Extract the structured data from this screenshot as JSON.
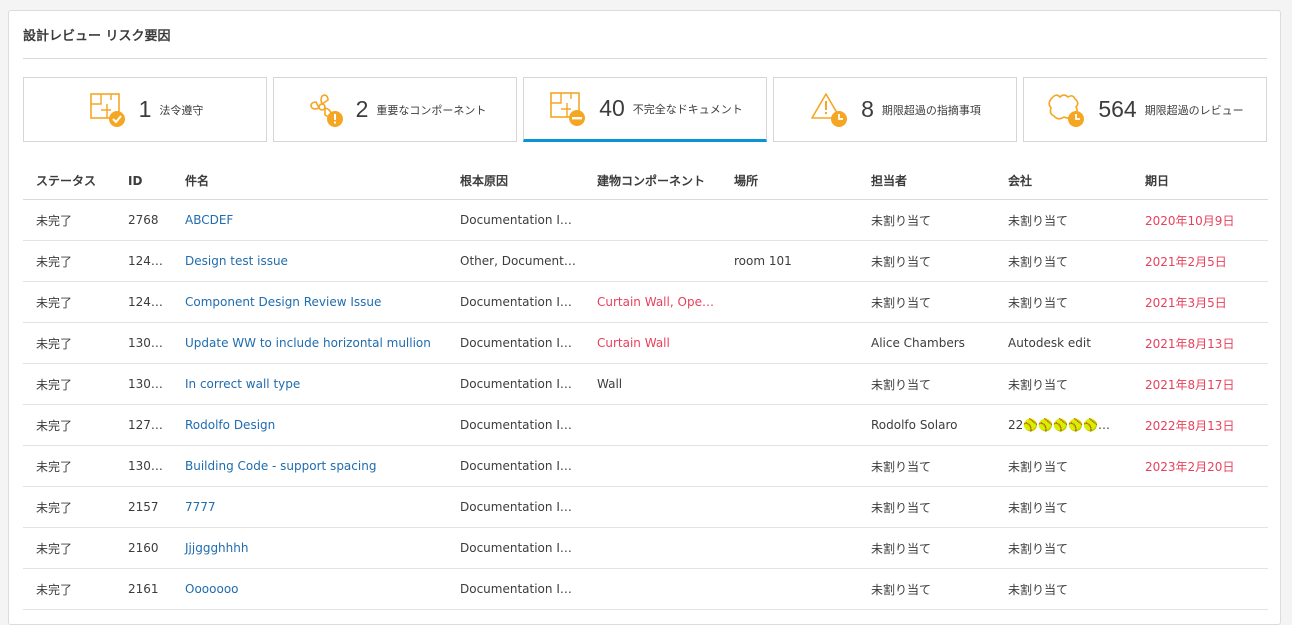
{
  "panel": {
    "title": "設計レビュー リスク要因"
  },
  "colors": {
    "accent": "#0696d7",
    "icon_orange": "#f5a623",
    "overdue_red": "#e8405c",
    "link_blue": "#1f6cae"
  },
  "cards": [
    {
      "count": "1",
      "label": "法令遵守",
      "icon": "blueprint-check-icon",
      "active": false
    },
    {
      "count": "2",
      "label": "重要なコンポーネント",
      "icon": "fan-warning-icon",
      "active": false
    },
    {
      "count": "40",
      "label": "不完全なドキュメント",
      "icon": "blueprint-minus-icon",
      "active": true
    },
    {
      "count": "8",
      "label": "期限超過の指摘事項",
      "icon": "warning-clock-icon",
      "active": false
    },
    {
      "count": "564",
      "label": "期限超過のレビュー",
      "icon": "cloud-clock-icon",
      "active": false
    }
  ],
  "table": {
    "headers": [
      "ステータス",
      "ID",
      "件名",
      "根本原因",
      "建物コンポーネント",
      "場所",
      "担当者",
      "会社",
      "期日"
    ],
    "rows": [
      {
        "status": "未完了",
        "id": "2768",
        "title": "ABCDEF",
        "cause": "Documentation I…",
        "comp1": "",
        "comp2": "",
        "location": "",
        "assignee": "未割り当て",
        "company": "未割り当て",
        "due": "2020年10月9日"
      },
      {
        "status": "未完了",
        "id": "124…",
        "title": "Design test issue",
        "cause": "Other, Document…",
        "comp1": "",
        "comp2": "",
        "location": "room 101",
        "assignee": "未割り当て",
        "company": "未割り当て",
        "due": "2021年2月5日"
      },
      {
        "status": "未完了",
        "id": "124…",
        "title": "Component Design Review Issue",
        "cause": "Documentation I…",
        "comp1": "Curtain Wall",
        "comp2": "Ope…",
        "location": "",
        "assignee": "未割り当て",
        "company": "未割り当て",
        "due": "2021年3月5日"
      },
      {
        "status": "未完了",
        "id": "130…",
        "title": "Update WW to include horizontal mullion",
        "cause": "Documentation I…",
        "comp1": "Curtain Wall",
        "comp2": "",
        "location": "",
        "assignee": "Alice Chambers",
        "company": "Autodesk edit",
        "due": "2021年8月13日"
      },
      {
        "status": "未完了",
        "id": "130…",
        "title": "In correct wall type",
        "cause": "Documentation I…",
        "comp1": "Wall",
        "comp2": "",
        "location": "",
        "assignee": "未割り当て",
        "company": "未割り当て",
        "due": "2021年8月17日"
      },
      {
        "status": "未完了",
        "id": "127…",
        "title": "Rodolfo Design",
        "cause": "Documentation I…",
        "comp1": "",
        "comp2": "",
        "location": "",
        "assignee": "Rodolfo Solaro",
        "company": "22🥎🥎🥎🥎🥎…",
        "due": "2022年8月13日"
      },
      {
        "status": "未完了",
        "id": "130…",
        "title": "Building Code - support spacing",
        "cause": "Documentation I…",
        "comp1": "",
        "comp2": "",
        "location": "",
        "assignee": "未割り当て",
        "company": "未割り当て",
        "due": "2023年2月20日"
      },
      {
        "status": "未完了",
        "id": "2157",
        "title": "7777",
        "cause": "Documentation I…",
        "comp1": "",
        "comp2": "",
        "location": "",
        "assignee": "未割り当て",
        "company": "未割り当て",
        "due": ""
      },
      {
        "status": "未完了",
        "id": "2160",
        "title": "Jjjggghhhh",
        "cause": "Documentation I…",
        "comp1": "",
        "comp2": "",
        "location": "",
        "assignee": "未割り当て",
        "company": "未割り当て",
        "due": ""
      },
      {
        "status": "未完了",
        "id": "2161",
        "title": "Ooooooo",
        "cause": "Documentation I…",
        "comp1": "",
        "comp2": "",
        "location": "",
        "assignee": "未割り当て",
        "company": "未割り当て",
        "due": ""
      }
    ]
  }
}
